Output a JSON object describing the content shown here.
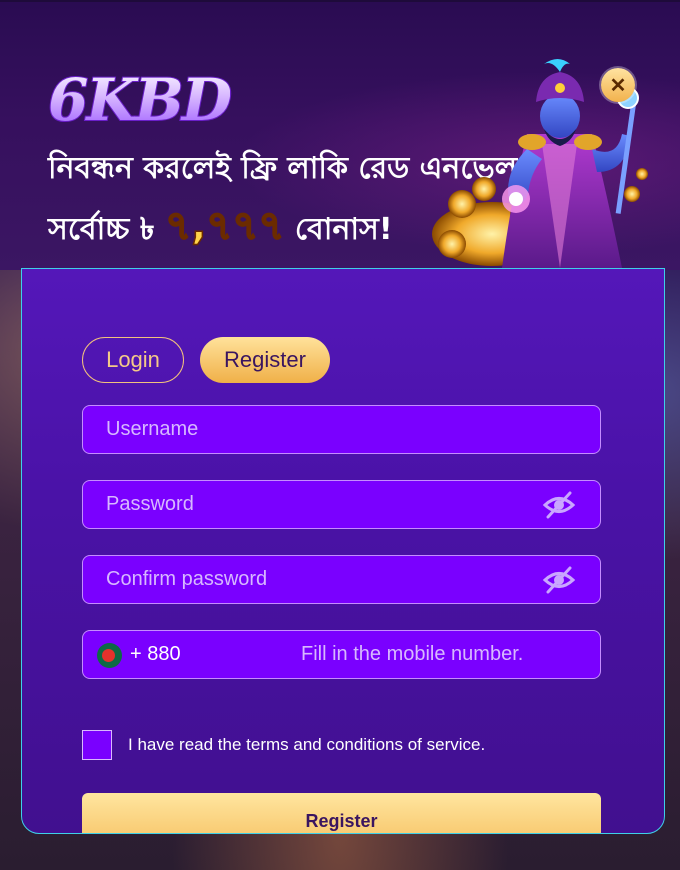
{
  "banner": {
    "logo_text": "6KBD",
    "promo_line1": "নিবন্ধন করলেই ফ্রি লাকি রেড এনভেলপ",
    "promo_line2_prefix": "সর্বোচ্চ ৳",
    "promo_amount": "৭,৭৭৭",
    "promo_line2_suffix": "বোনাস!",
    "close_symbol": "✕"
  },
  "tabs": {
    "login_label": "Login",
    "register_label": "Register",
    "active": "Register"
  },
  "form": {
    "username_placeholder": "Username",
    "password_placeholder": "Password",
    "confirm_password_placeholder": "Confirm password",
    "country_code": "+ 880",
    "phone_placeholder": "Fill in the mobile number.",
    "terms_text": "I have read the terms and conditions of service.",
    "submit_label": "Register"
  },
  "icons": {
    "close": "close-icon",
    "eye_password": "eye-off-icon",
    "eye_confirm": "eye-off-icon",
    "flag": "bangladesh-flag-icon"
  },
  "colors": {
    "accent_gold": "#f0b048",
    "field_bg": "#7a00ff",
    "panel_bg": "#5417b9"
  }
}
